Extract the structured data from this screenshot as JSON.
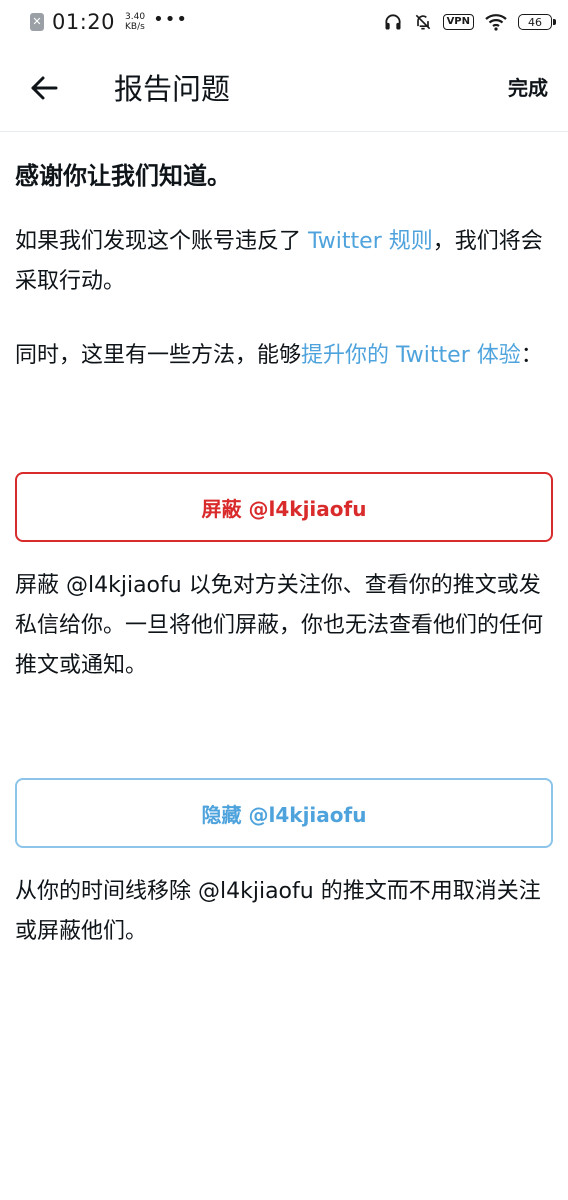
{
  "status_bar": {
    "time": "01:20",
    "speed_value": "3.40",
    "speed_unit": "KB/s",
    "more": "•••",
    "vpn": "VPN",
    "battery": "46"
  },
  "header": {
    "title": "报告问题",
    "done_label": "完成"
  },
  "content": {
    "heading": "感谢你让我们知道。",
    "para1_before": "如果我们发现这个账号违反了 ",
    "para1_link": "Twitter 规则",
    "para1_after": "，我们将会采取行动。",
    "para2_before": "同时，这里有一些方法，能够",
    "para2_link": "提升你的 Twitter 体验",
    "para2_after": "：",
    "block_button_label": "屏蔽 @l4kjiaofu",
    "block_description": "屏蔽 @l4kjiaofu 以免对方关注你、查看你的推文或发私信给你。一旦将他们屏蔽，你也无法查看他们的任何推文或通知。",
    "mute_button_label": "隐藏 @l4kjiaofu",
    "mute_description": "从你的时间线移除 @l4kjiaofu 的推文而不用取消关注或屏蔽他们。"
  },
  "colors": {
    "link": "#4fa3dd",
    "block_red": "#d92b2b",
    "mute_blue_border": "#8cc4ea"
  },
  "icons": {
    "back": "arrow-left-icon",
    "headphones": "headphones-icon",
    "mute_bell": "bell-off-icon",
    "wifi": "wifi-icon",
    "notification_close": "close-icon"
  }
}
